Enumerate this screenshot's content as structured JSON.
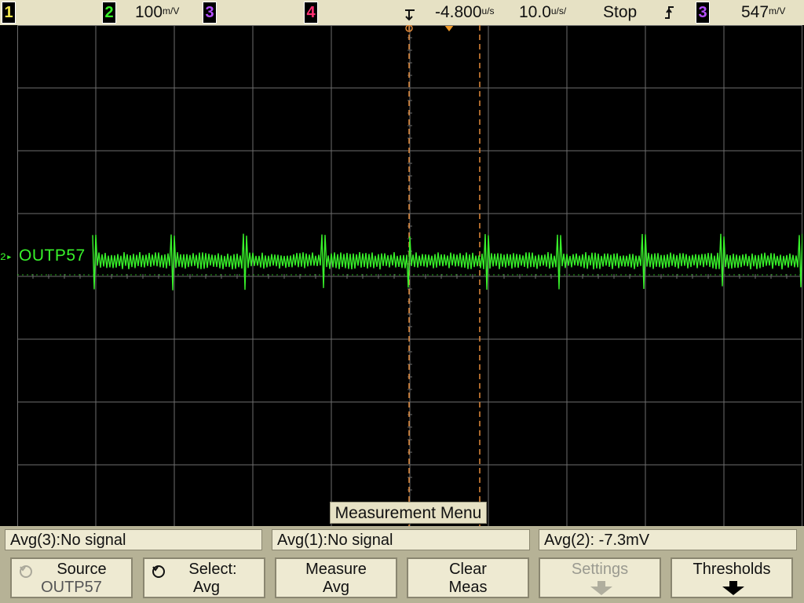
{
  "top_bar": {
    "ch1_label": "1",
    "ch2_label": "2",
    "ch2_scale": "100",
    "ch2_scale_unit": "m/V",
    "ch3_label": "3",
    "ch4_label": "4",
    "time_offset": "-4.800",
    "time_offset_unit": "u/s",
    "timebase": "10.0",
    "timebase_unit": "u/s/",
    "run_state": "Stop",
    "trigger_slope": "rising-edge-icon",
    "trigger_source": "3",
    "trigger_level": "547",
    "trigger_level_unit": "m/V"
  },
  "waveform": {
    "channel_marker": "2",
    "label": "OUTP57",
    "color": "#38f22a"
  },
  "colors": {
    "ch1": "#f2e64a",
    "ch2": "#38f22a",
    "ch3": "#b550ff",
    "ch4": "#ff2f72",
    "cursor": "#e38a3a",
    "grid": "#6e6e6e",
    "panel": "#e6e1c4"
  },
  "menu": {
    "title": "Measurement Menu"
  },
  "measurements": [
    "Avg(3):No signal",
    "Avg(1):No signal",
    "Avg(2): -7.3mV"
  ],
  "softkeys": [
    {
      "line1": "Source",
      "line2": "OUTP57",
      "icon": "knob-icon",
      "enabled": true
    },
    {
      "line1": "Select:",
      "line2": "Avg",
      "icon": "knob-icon",
      "enabled": true
    },
    {
      "line1": "Measure",
      "line2": "Avg",
      "icon": "",
      "enabled": true
    },
    {
      "line1": "Clear",
      "line2": "Meas",
      "icon": "",
      "enabled": true
    },
    {
      "line1": "Settings",
      "line2": "",
      "icon": "down-arrow-icon",
      "enabled": false
    },
    {
      "line1": "Thresholds",
      "line2": "",
      "icon": "down-arrow-icon",
      "enabled": true
    }
  ]
}
